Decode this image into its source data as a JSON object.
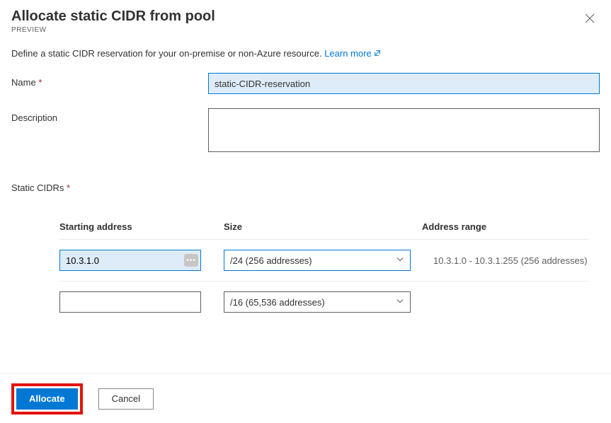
{
  "header": {
    "title": "Allocate static CIDR from pool",
    "preview": "PREVIEW"
  },
  "description": {
    "text": "Define a static CIDR reservation for your on-premise or non-Azure resource.",
    "link_label": "Learn more"
  },
  "form": {
    "name": {
      "label": "Name",
      "value": "static-CIDR-reservation"
    },
    "description_field": {
      "label": "Description",
      "value": ""
    },
    "static_cidrs_label": "Static CIDRs"
  },
  "grid": {
    "headers": {
      "starting_address": "Starting address",
      "size": "Size",
      "address_range": "Address range"
    },
    "rows": [
      {
        "starting_address": "10.3.1.0",
        "size": "/24 (256 addresses)",
        "range": "10.3.1.0 - 10.3.1.255 (256 addresses)",
        "has_badge": true,
        "badge": "•••",
        "highlighted": true
      },
      {
        "starting_address": "",
        "size": "/16 (65,536 addresses)",
        "range": "",
        "has_badge": false,
        "highlighted": false
      }
    ]
  },
  "footer": {
    "allocate": "Allocate",
    "cancel": "Cancel"
  }
}
